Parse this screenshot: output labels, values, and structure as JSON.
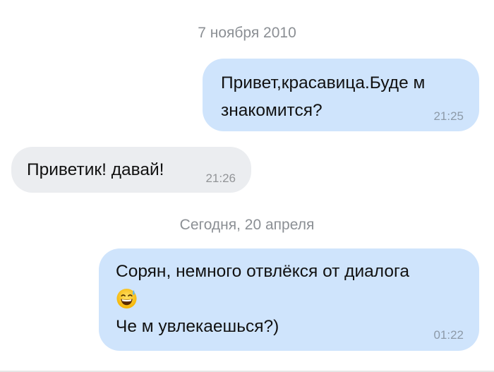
{
  "conversation": {
    "date_1": "7 ноября 2010",
    "date_2": "Сегодня, 20 апреля",
    "messages": [
      {
        "direction": "outgoing",
        "lines": [
          "Привет,красавица.Буде м",
          "знакомится?"
        ],
        "time": "21:25"
      },
      {
        "direction": "incoming",
        "lines": [
          "Приветик! давай!"
        ],
        "time": "21:26"
      },
      {
        "direction": "outgoing",
        "lines": [
          "Сорян, немного отвлёкся от диалога",
          "Че м увлекаешься?)"
        ],
        "emoji": "grinning-face-with-sweat-emoji",
        "time": "01:22"
      }
    ]
  },
  "colors": {
    "outgoing_bubble": "#cfe4fc",
    "incoming_bubble": "#ebedf0",
    "date_text": "#8b8f94",
    "time_text": "#8d9aa8"
  }
}
